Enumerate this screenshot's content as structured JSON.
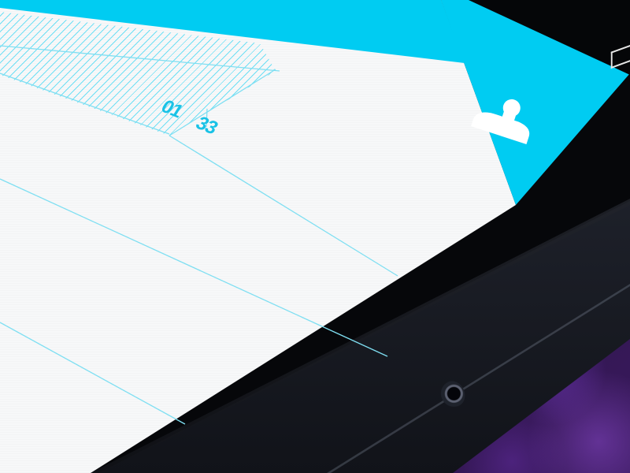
{
  "calendar": {
    "selected_day": {
      "month_label": "01",
      "day_label": "33"
    }
  },
  "header": {
    "profile_button": {
      "icon": "user-silhouette-icon"
    }
  },
  "statusbar": {
    "icon": "back-navigation-icon"
  },
  "device": {
    "earpiece": "earpiece-speaker"
  },
  "colors": {
    "accent": "#00ccf2",
    "screen_background": "#f7f8f9",
    "grid_line": "#7fdff2",
    "bezel": "#06070a",
    "backdrop": "#2a1345"
  }
}
